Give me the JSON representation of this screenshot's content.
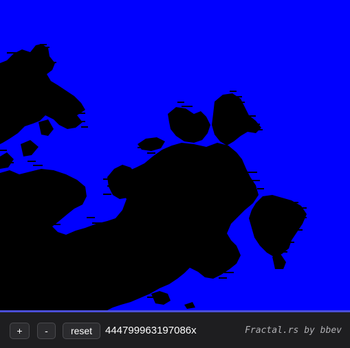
{
  "app": {
    "title": "Fractal.rs"
  },
  "colors": {
    "background_fill": "#0000ff",
    "fractal_fill": "#000000",
    "divider": "#4b4fd8",
    "toolbar_bg": "#1e1e20"
  },
  "toolbar": {
    "zoom_in_label": "+",
    "zoom_out_label": "-",
    "reset_label": "reset",
    "zoom_level": "444799963197086x",
    "credit": "Fractal.rs by bbev"
  }
}
